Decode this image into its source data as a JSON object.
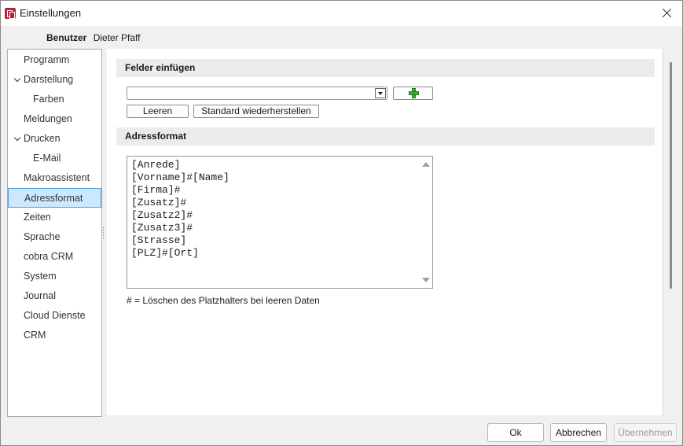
{
  "window": {
    "title": "Einstellungen"
  },
  "user": {
    "label": "Benutzer",
    "name": "Dieter Pfaff"
  },
  "nav": {
    "items": [
      {
        "label": "Programm",
        "indent": 0,
        "expanded": false
      },
      {
        "label": "Darstellung",
        "indent": 0,
        "expanded": true
      },
      {
        "label": "Farben",
        "indent": 1,
        "expanded": false
      },
      {
        "label": "Meldungen",
        "indent": 0,
        "expanded": false
      },
      {
        "label": "Drucken",
        "indent": 0,
        "expanded": true
      },
      {
        "label": "E-Mail",
        "indent": 1,
        "expanded": false
      },
      {
        "label": "Makroassistent",
        "indent": 0,
        "expanded": false
      },
      {
        "label": "Adressformat",
        "indent": 0,
        "expanded": false,
        "selected": true
      },
      {
        "label": "Zeiten",
        "indent": 0,
        "expanded": false
      },
      {
        "label": "Sprache",
        "indent": 0,
        "expanded": false
      },
      {
        "label": "cobra CRM",
        "indent": 0,
        "expanded": false
      },
      {
        "label": "System",
        "indent": 0,
        "expanded": false
      },
      {
        "label": "Journal",
        "indent": 0,
        "expanded": false
      },
      {
        "label": "Cloud Dienste",
        "indent": 0,
        "expanded": false
      },
      {
        "label": "CRM",
        "indent": 0,
        "expanded": false
      }
    ]
  },
  "fields": {
    "heading": "Felder einfügen",
    "select_value": "",
    "clear_label": "Leeren",
    "restore_label": "Standard wiederherstellen",
    "add_icon": "plus-icon",
    "add_icon_color": "#3aa935"
  },
  "address": {
    "heading": "Adressformat",
    "lines": [
      "[Anrede]",
      "[Vorname]#[Name]",
      "[Firma]#",
      "[Zusatz]#",
      "[Zusatz2]#",
      "[Zusatz3]#",
      "[Strasse]",
      "[PLZ]#[Ort]"
    ],
    "hint": "# = Löschen des Platzhalters bei leeren Daten"
  },
  "footer": {
    "ok_label": "Ok",
    "cancel_label": "Abbrechen",
    "apply_label": "Übernehmen"
  }
}
